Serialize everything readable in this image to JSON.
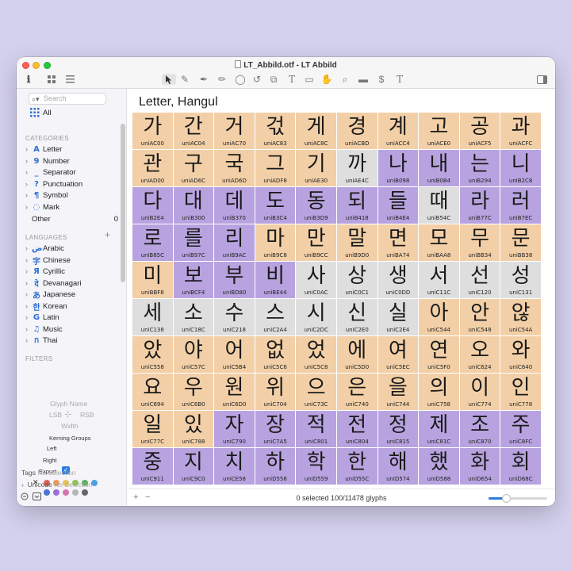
{
  "window": {
    "title": "LT_Abbild.otf - LT Abbild"
  },
  "sidebar": {
    "search_placeholder": "Search",
    "all_label": "All",
    "categories_heading": "CATEGORIES",
    "categories": [
      {
        "icon": "A",
        "label": "Letter"
      },
      {
        "icon": "9",
        "label": "Number"
      },
      {
        "icon": "_",
        "label": "Separator"
      },
      {
        "icon": "?",
        "label": "Punctuation"
      },
      {
        "icon": "¶",
        "label": "Symbol"
      },
      {
        "icon": "◌",
        "label": "Mark"
      },
      {
        "icon": "",
        "label": "Other",
        "count": "0"
      }
    ],
    "languages_heading": "LANGUAGES",
    "languages": [
      {
        "icon": "ض",
        "label": "Arabic"
      },
      {
        "icon": "字",
        "label": "Chinese"
      },
      {
        "icon": "Я",
        "label": "Cyrillic"
      },
      {
        "icon": "दे",
        "label": "Devanagari"
      },
      {
        "icon": "あ",
        "label": "Japanese"
      },
      {
        "icon": "한",
        "label": "Korean"
      },
      {
        "icon": "G",
        "label": "Latin"
      },
      {
        "icon": "♫",
        "label": "Music"
      },
      {
        "icon": "ก",
        "label": "Thai"
      }
    ],
    "filters_heading": "FILTERS",
    "filters": {
      "glyph_name": "Glyph Name",
      "lsb": "LSB",
      "rsb": "RSB",
      "width": "Width",
      "kerning_groups": "Kerning Groups",
      "left": "Left",
      "right": "Right",
      "export": "Export",
      "tags_label": "Tags",
      "tags_value": "No Selection",
      "unicode_label": "Unicode",
      "unicode_value": "No Selection"
    },
    "color_dots": [
      "#e0655a",
      "#ee9a4f",
      "#e7c65e",
      "#8fc05a",
      "#59b35c",
      "#4f9fe0",
      "#4a72d8",
      "#9a6fd8",
      "#d774b0",
      "#b7b7b7",
      "#666666"
    ]
  },
  "main": {
    "heading": "Letter, Hangul",
    "status": "0 selected 100/11478 glyphs",
    "zoom_level": 0.3,
    "glyphs": [
      {
        "g": "가",
        "c": "uniAC00",
        "k": "o"
      },
      {
        "g": "간",
        "c": "uniAC04",
        "k": "o"
      },
      {
        "g": "거",
        "c": "uniAC70",
        "k": "o"
      },
      {
        "g": "걳",
        "c": "uniAC83",
        "k": "o"
      },
      {
        "g": "게",
        "c": "uniAC8C",
        "k": "o"
      },
      {
        "g": "경",
        "c": "uniACBD",
        "k": "o"
      },
      {
        "g": "계",
        "c": "uniACC4",
        "k": "o"
      },
      {
        "g": "고",
        "c": "uniACE0",
        "k": "o"
      },
      {
        "g": "공",
        "c": "uniACF5",
        "k": "o"
      },
      {
        "g": "과",
        "c": "uniACFC",
        "k": "o"
      },
      {
        "g": "관",
        "c": "uniAD00",
        "k": "o"
      },
      {
        "g": "구",
        "c": "uniAD6C",
        "k": "o"
      },
      {
        "g": "국",
        "c": "uniAD6D",
        "k": "o"
      },
      {
        "g": "그",
        "c": "uniADF8",
        "k": "o"
      },
      {
        "g": "기",
        "c": "uniAE30",
        "k": "o"
      },
      {
        "g": "까",
        "c": "uniAE4C",
        "k": "g"
      },
      {
        "g": "나",
        "c": "uniB098",
        "k": "p"
      },
      {
        "g": "내",
        "c": "uniB0B4",
        "k": "p"
      },
      {
        "g": "는",
        "c": "uniB294",
        "k": "p"
      },
      {
        "g": "니",
        "c": "uniB2C8",
        "k": "p"
      },
      {
        "g": "다",
        "c": "uniB2E4",
        "k": "p"
      },
      {
        "g": "대",
        "c": "uniB300",
        "k": "p"
      },
      {
        "g": "데",
        "c": "uniB370",
        "k": "p"
      },
      {
        "g": "도",
        "c": "uniB3C4",
        "k": "p"
      },
      {
        "g": "동",
        "c": "uniB3D9",
        "k": "p"
      },
      {
        "g": "되",
        "c": "uniB418",
        "k": "p"
      },
      {
        "g": "들",
        "c": "uniB4E4",
        "k": "p"
      },
      {
        "g": "때",
        "c": "uniB54C",
        "k": "g"
      },
      {
        "g": "라",
        "c": "uniB77C",
        "k": "p"
      },
      {
        "g": "러",
        "c": "uniB7EC",
        "k": "p"
      },
      {
        "g": "로",
        "c": "uniB85C",
        "k": "p"
      },
      {
        "g": "를",
        "c": "uniB97C",
        "k": "p"
      },
      {
        "g": "리",
        "c": "uniB9AC",
        "k": "p"
      },
      {
        "g": "마",
        "c": "uniB9C8",
        "k": "o"
      },
      {
        "g": "만",
        "c": "uniB9CC",
        "k": "o"
      },
      {
        "g": "말",
        "c": "uniB9D0",
        "k": "o"
      },
      {
        "g": "면",
        "c": "uniBA74",
        "k": "o"
      },
      {
        "g": "모",
        "c": "uniBAA8",
        "k": "o"
      },
      {
        "g": "무",
        "c": "uniBB34",
        "k": "o"
      },
      {
        "g": "문",
        "c": "uniBB38",
        "k": "o"
      },
      {
        "g": "미",
        "c": "uniBBF8",
        "k": "o"
      },
      {
        "g": "보",
        "c": "uniBCF4",
        "k": "p"
      },
      {
        "g": "부",
        "c": "uniBD80",
        "k": "p"
      },
      {
        "g": "비",
        "c": "uniBE44",
        "k": "p"
      },
      {
        "g": "사",
        "c": "uniC0AC",
        "k": "g"
      },
      {
        "g": "상",
        "c": "uniC0C1",
        "k": "g"
      },
      {
        "g": "생",
        "c": "uniC0DD",
        "k": "g"
      },
      {
        "g": "서",
        "c": "uniC11C",
        "k": "g"
      },
      {
        "g": "선",
        "c": "uniC120",
        "k": "g"
      },
      {
        "g": "성",
        "c": "uniC131",
        "k": "g"
      },
      {
        "g": "세",
        "c": "uniC138",
        "k": "g"
      },
      {
        "g": "소",
        "c": "uniC18C",
        "k": "g"
      },
      {
        "g": "수",
        "c": "uniC218",
        "k": "g"
      },
      {
        "g": "스",
        "c": "uniC2A4",
        "k": "g"
      },
      {
        "g": "시",
        "c": "uniC2DC",
        "k": "g"
      },
      {
        "g": "신",
        "c": "uniC2E0",
        "k": "g"
      },
      {
        "g": "실",
        "c": "uniC2E4",
        "k": "g"
      },
      {
        "g": "아",
        "c": "uniC544",
        "k": "o"
      },
      {
        "g": "안",
        "c": "uniC548",
        "k": "o"
      },
      {
        "g": "않",
        "c": "uniC54A",
        "k": "o"
      },
      {
        "g": "았",
        "c": "uniC558",
        "k": "o"
      },
      {
        "g": "야",
        "c": "uniC57C",
        "k": "o"
      },
      {
        "g": "어",
        "c": "uniC5B4",
        "k": "o"
      },
      {
        "g": "없",
        "c": "uniC5C6",
        "k": "o"
      },
      {
        "g": "었",
        "c": "uniC5C8",
        "k": "o"
      },
      {
        "g": "에",
        "c": "uniC5D0",
        "k": "o"
      },
      {
        "g": "여",
        "c": "uniC5EC",
        "k": "o"
      },
      {
        "g": "연",
        "c": "uniC5F0",
        "k": "o"
      },
      {
        "g": "오",
        "c": "uniC624",
        "k": "o"
      },
      {
        "g": "와",
        "c": "uniC640",
        "k": "o"
      },
      {
        "g": "요",
        "c": "uniC694",
        "k": "o"
      },
      {
        "g": "우",
        "c": "uniC6B0",
        "k": "o"
      },
      {
        "g": "원",
        "c": "uniC6D0",
        "k": "o"
      },
      {
        "g": "위",
        "c": "uniC704",
        "k": "o"
      },
      {
        "g": "으",
        "c": "uniC73C",
        "k": "o"
      },
      {
        "g": "은",
        "c": "uniC740",
        "k": "o"
      },
      {
        "g": "을",
        "c": "uniC744",
        "k": "o"
      },
      {
        "g": "의",
        "c": "uniC758",
        "k": "o"
      },
      {
        "g": "이",
        "c": "uniC774",
        "k": "o"
      },
      {
        "g": "인",
        "c": "uniC778",
        "k": "o"
      },
      {
        "g": "일",
        "c": "uniC77C",
        "k": "o"
      },
      {
        "g": "있",
        "c": "uniC788",
        "k": "o"
      },
      {
        "g": "자",
        "c": "uniC790",
        "k": "p"
      },
      {
        "g": "장",
        "c": "uniC7A5",
        "k": "p"
      },
      {
        "g": "적",
        "c": "uniC801",
        "k": "p"
      },
      {
        "g": "전",
        "c": "uniC804",
        "k": "p"
      },
      {
        "g": "정",
        "c": "uniC815",
        "k": "p"
      },
      {
        "g": "제",
        "c": "uniC81C",
        "k": "p"
      },
      {
        "g": "조",
        "c": "uniC870",
        "k": "p"
      },
      {
        "g": "주",
        "c": "uniC8FC",
        "k": "p"
      },
      {
        "g": "중",
        "c": "uniC911",
        "k": "p"
      },
      {
        "g": "지",
        "c": "uniC9C0",
        "k": "p"
      },
      {
        "g": "치",
        "c": "uniCE58",
        "k": "p"
      },
      {
        "g": "하",
        "c": "uniD558",
        "k": "p"
      },
      {
        "g": "학",
        "c": "uniD559",
        "k": "p"
      },
      {
        "g": "한",
        "c": "uniD55C",
        "k": "p"
      },
      {
        "g": "해",
        "c": "uniD574",
        "k": "p"
      },
      {
        "g": "했",
        "c": "uniD588",
        "k": "p"
      },
      {
        "g": "화",
        "c": "uniD654",
        "k": "p"
      },
      {
        "g": "회",
        "c": "uniD68C",
        "k": "p"
      }
    ]
  }
}
